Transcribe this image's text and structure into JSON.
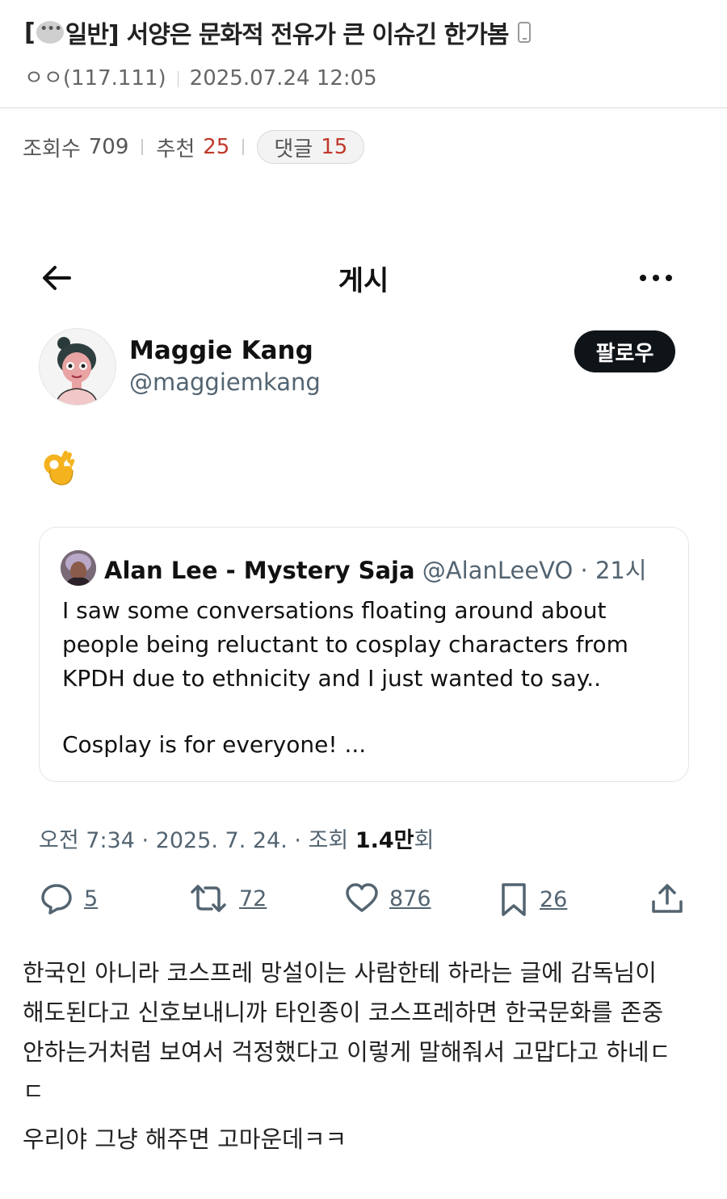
{
  "post": {
    "title_open": "[",
    "title_category": "일반]",
    "title_text": "서양은 문화적 전유가 큰 이슈긴 한가봄",
    "author": "ㅇㅇ(117.111)",
    "date": "2025.07.24 12:05"
  },
  "stats": {
    "views_label": "조회수",
    "views": "709",
    "recommend_label": "추천",
    "recommend": "25",
    "comments_label": "댓글",
    "comments": "15"
  },
  "tweet_nav": {
    "title": "게시"
  },
  "tweet": {
    "name": "Maggie Kang",
    "handle": "@maggiemkang",
    "follow_label": "팔로우",
    "meta_prefix": "오전 7:34 · 2025. 7. 24. · 조회 ",
    "views": "1.4만",
    "meta_suffix": "회"
  },
  "quote": {
    "name": "Alan Lee - Mystery Saja",
    "handle_time": "@AlanLeeVO · 21시",
    "lines": [
      "I saw some conversations floating around about",
      "people being reluctant to cosplay characters from",
      "KPDH due to ethnicity and I just wanted to say..",
      "Cosplay is for everyone! ..."
    ]
  },
  "actions": {
    "replies": "5",
    "retweets": "72",
    "likes": "876",
    "bookmarks": "26"
  },
  "body": {
    "lines": [
      "한국인 아니라 코스프레 망설이는 사람한테 하라는 글에 감독님이",
      "해도된다고 신호보내니까 타인종이 코스프레하면 한국문화를 존중",
      "안하는거처럼 보여서 걱정했다고 이렇게 말해줘서 고맙다고 하네ㄷ",
      "ㄷ"
    ],
    "last": "우리야 그냥 해주면 고마운데ㅋㅋ"
  },
  "colors": {
    "accent_red": "#c0392b",
    "follow_bg": "#0f1419",
    "meta_gray": "#536471"
  },
  "icons": [
    "speech-bubble-icon",
    "phone-icon",
    "back-arrow-icon",
    "more-icon",
    "ok-hand-emoji",
    "reply-icon",
    "retweet-icon",
    "like-icon",
    "bookmark-icon",
    "share-icon"
  ]
}
